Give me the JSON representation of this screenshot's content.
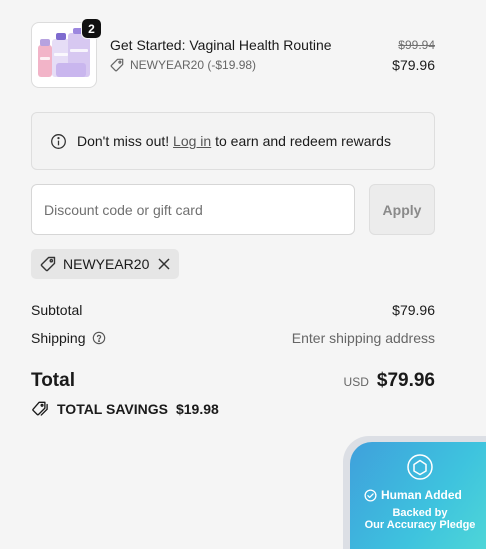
{
  "product": {
    "title": "Get Started: Vaginal Health Routine",
    "quantity": "2",
    "discount": "NEWYEAR20 (-$19.98)",
    "original_price": "$99.94",
    "price": "$79.96",
    "image_icon": "product-bottles-image"
  },
  "rewards": {
    "prefix": "Don't miss out!",
    "link": "Log in",
    "suffix": "to earn and redeem rewards",
    "icon": "info-icon"
  },
  "discount_form": {
    "placeholder": "Discount code or gift card",
    "value": "",
    "apply_label": "Apply"
  },
  "applied_code": {
    "code": "NEWYEAR20",
    "icon": "tag-icon",
    "remove_icon": "close-icon"
  },
  "summary": {
    "subtotal_label": "Subtotal",
    "subtotal_value": "$79.96",
    "shipping_label": "Shipping",
    "shipping_value": "Enter shipping address",
    "total_label": "Total",
    "currency": "USD",
    "total_value": "$79.96",
    "savings_label": "TOTAL SAVINGS",
    "savings_value": "$19.98"
  },
  "badge": {
    "title": "Human Added",
    "line1": "Backed by",
    "line2": "Our Accuracy Pledge",
    "colors": {
      "start": "#3fa0dc",
      "end": "#52dbd6"
    }
  },
  "colors": {
    "background": "#f5f5f5",
    "text": "#1a1a1a",
    "muted": "#666666",
    "badge_dark": "#111111"
  }
}
